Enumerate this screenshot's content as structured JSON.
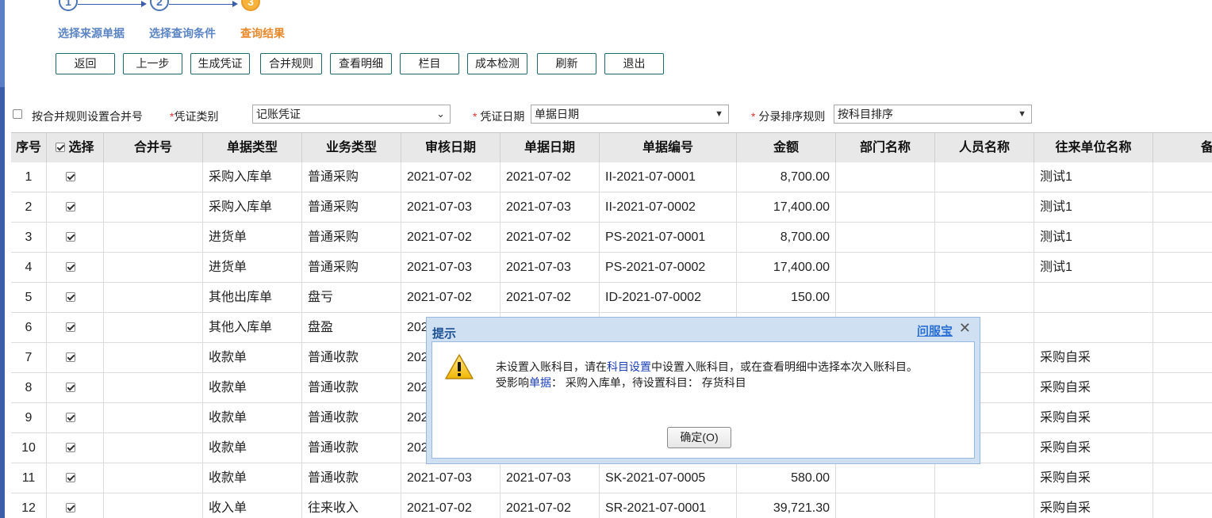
{
  "steps": [
    {
      "num": "1",
      "label": "选择来源单据"
    },
    {
      "num": "2",
      "label": "选择查询条件"
    },
    {
      "num": "3",
      "label": "查询结果"
    }
  ],
  "toolbar": {
    "back": "返回",
    "prev": "上一步",
    "generate": "生成凭证",
    "merge_rule": "合并规则",
    "view_detail": "查看明细",
    "columns": "栏目",
    "cost_check": "成本检测",
    "refresh": "刷新",
    "exit": "退出"
  },
  "filters": {
    "merge_checkbox_label": "按合并规则设置合并号",
    "required_mark": "*",
    "voucher_type_label": "凭证类别",
    "voucher_type_value": "记账凭证",
    "voucher_date_label": "凭证日期",
    "voucher_date_value": "单据日期",
    "sort_rule_label": "分录排序规则",
    "sort_rule_value": "按科目排序"
  },
  "table": {
    "headers": [
      "序号",
      "选择",
      "合并号",
      "单据类型",
      "业务类型",
      "审核日期",
      "单据日期",
      "单据编号",
      "金额",
      "部门名称",
      "人员名称",
      "往来单位名称",
      "备注"
    ],
    "rows": [
      {
        "seq": "1",
        "merge": "",
        "doc_type": "采购入库单",
        "biz_type": "普通采购",
        "audit_date": "2021-07-02",
        "doc_date": "2021-07-02",
        "doc_no": "II-2021-07-0001",
        "amount": "8,700.00",
        "dept": "",
        "person": "",
        "partner": "测试1"
      },
      {
        "seq": "2",
        "merge": "",
        "doc_type": "采购入库单",
        "biz_type": "普通采购",
        "audit_date": "2021-07-03",
        "doc_date": "2021-07-03",
        "doc_no": "II-2021-07-0002",
        "amount": "17,400.00",
        "dept": "",
        "person": "",
        "partner": "测试1"
      },
      {
        "seq": "3",
        "merge": "",
        "doc_type": "进货单",
        "biz_type": "普通采购",
        "audit_date": "2021-07-02",
        "doc_date": "2021-07-02",
        "doc_no": "PS-2021-07-0001",
        "amount": "8,700.00",
        "dept": "",
        "person": "",
        "partner": "测试1"
      },
      {
        "seq": "4",
        "merge": "",
        "doc_type": "进货单",
        "biz_type": "普通采购",
        "audit_date": "2021-07-03",
        "doc_date": "2021-07-03",
        "doc_no": "PS-2021-07-0002",
        "amount": "17,400.00",
        "dept": "",
        "person": "",
        "partner": "测试1"
      },
      {
        "seq": "5",
        "merge": "",
        "doc_type": "其他出库单",
        "biz_type": "盘亏",
        "audit_date": "2021-07-02",
        "doc_date": "2021-07-02",
        "doc_no": "ID-2021-07-0002",
        "amount": "150.00",
        "dept": "",
        "person": "",
        "partner": ""
      },
      {
        "seq": "6",
        "merge": "",
        "doc_type": "其他入库单",
        "biz_type": "盘盈",
        "audit_date": "202",
        "doc_date": "",
        "doc_no": "",
        "amount": "",
        "dept": "",
        "person": "",
        "partner": ""
      },
      {
        "seq": "7",
        "merge": "",
        "doc_type": "收款单",
        "biz_type": "普通收款",
        "audit_date": "202",
        "doc_date": "",
        "doc_no": "",
        "amount": "",
        "dept": "",
        "person": "",
        "partner": "采购自采"
      },
      {
        "seq": "8",
        "merge": "",
        "doc_type": "收款单",
        "biz_type": "普通收款",
        "audit_date": "202",
        "doc_date": "",
        "doc_no": "",
        "amount": "",
        "dept": "",
        "person": "",
        "partner": "采购自采"
      },
      {
        "seq": "9",
        "merge": "",
        "doc_type": "收款单",
        "biz_type": "普通收款",
        "audit_date": "202",
        "doc_date": "",
        "doc_no": "",
        "amount": "",
        "dept": "",
        "person": "",
        "partner": "采购自采"
      },
      {
        "seq": "10",
        "merge": "",
        "doc_type": "收款单",
        "biz_type": "普通收款",
        "audit_date": "202",
        "doc_date": "",
        "doc_no": "",
        "amount": "",
        "dept": "",
        "person": "",
        "partner": "采购自采"
      },
      {
        "seq": "11",
        "merge": "",
        "doc_type": "收款单",
        "biz_type": "普通收款",
        "audit_date": "2021-07-03",
        "doc_date": "2021-07-03",
        "doc_no": "SK-2021-07-0005",
        "amount": "580.00",
        "dept": "",
        "person": "",
        "partner": "采购自采"
      },
      {
        "seq": "12",
        "merge": "",
        "doc_type": "收入单",
        "biz_type": "往来收入",
        "audit_date": "2021-07-02",
        "doc_date": "2021-07-02",
        "doc_no": "SR-2021-07-0001",
        "amount": "39,721.30",
        "dept": "",
        "person": "",
        "partner": "采购自采"
      }
    ]
  },
  "dialog": {
    "title": "提示",
    "help_link": "问服宝",
    "close": "✕",
    "line1_a": "未设置入账科目，请在",
    "line1_link": "科目设置",
    "line1_b": "中设置入账科目，或在查看明细中选择本次入账科目。",
    "line2_a": "受影响",
    "line2_link": "单据",
    "line2_b": "： 采购入库单，待设置科目： 存货科目",
    "ok": "确定(O)"
  }
}
